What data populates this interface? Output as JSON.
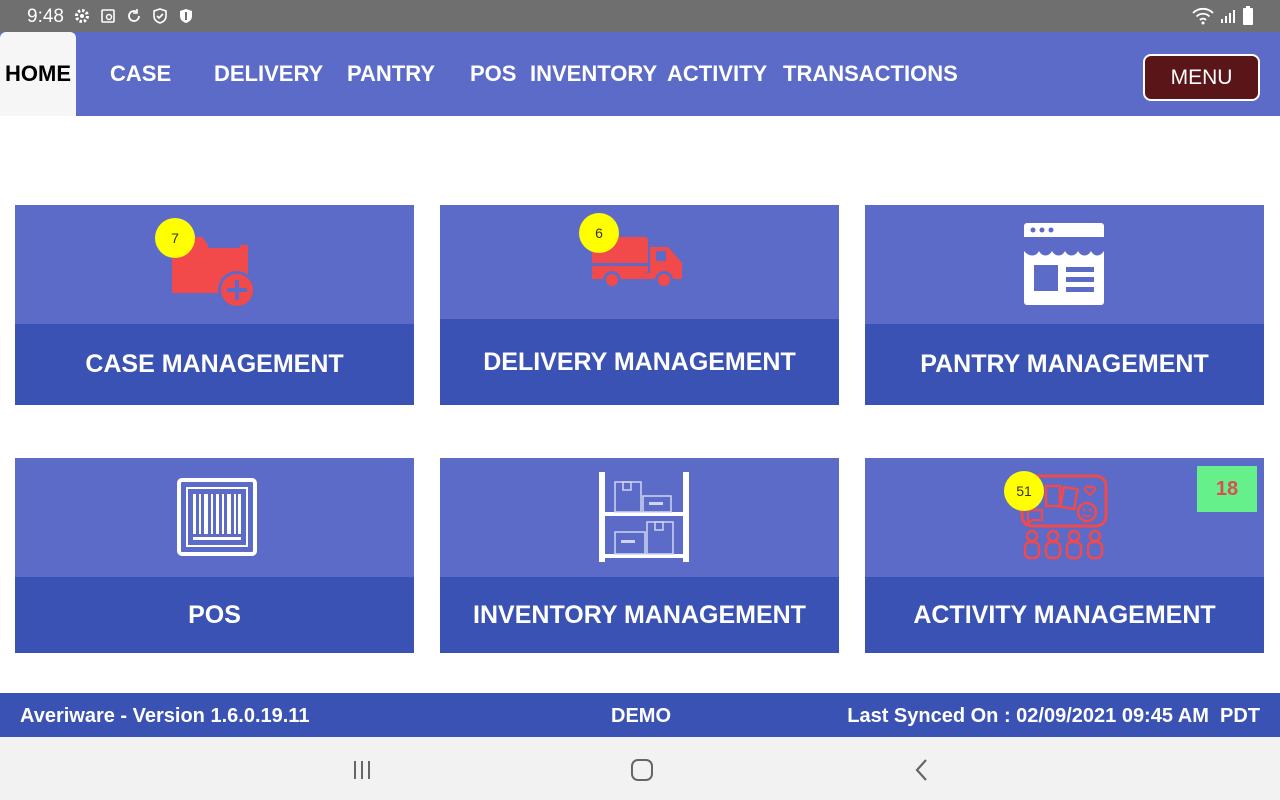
{
  "status_bar": {
    "time": "9:48",
    "icons_left": [
      "gear-icon",
      "screenshot-icon",
      "sync-icon",
      "shield-check-icon",
      "shield-icon"
    ],
    "icons_right": [
      "wifi-icon",
      "signal-icon",
      "battery-icon"
    ]
  },
  "nav": {
    "tabs": [
      {
        "label": "HOME",
        "active": true
      },
      {
        "label": "CASE"
      },
      {
        "label": "DELIVERY"
      },
      {
        "label": "PANTRY"
      },
      {
        "label": "POS"
      },
      {
        "label": "INVENTORY"
      },
      {
        "label": "ACTIVITY"
      },
      {
        "label": "TRANSACTIONS"
      }
    ],
    "menu_label": "MENU"
  },
  "cards": [
    {
      "title": "CASE MANAGEMENT",
      "icon": "folder-add-icon",
      "badge": "7"
    },
    {
      "title": "DELIVERY MANAGEMENT",
      "icon": "truck-icon",
      "badge": "6"
    },
    {
      "title": "PANTRY MANAGEMENT",
      "icon": "storefront-icon"
    },
    {
      "title": "POS",
      "icon": "barcode-icon"
    },
    {
      "title": "INVENTORY MANAGEMENT",
      "icon": "shelves-icon"
    },
    {
      "title": "ACTIVITY MANAGEMENT",
      "icon": "activity-board-icon",
      "badge": "51",
      "count": "18"
    }
  ],
  "footer": {
    "version": "Averiware - Version 1.6.0.19.11",
    "env": "DEMO",
    "last_synced": "Last Synced On : 02/09/2021 09:45 AM  PDT"
  },
  "colors": {
    "nav_bg": "#5c6bc8",
    "card_bottom": "#3a52b4",
    "menu_bg": "#5a1518",
    "icon_red": "#f24a4a",
    "badge_yellow": "#ffff00",
    "count_green": "#66f08c"
  }
}
